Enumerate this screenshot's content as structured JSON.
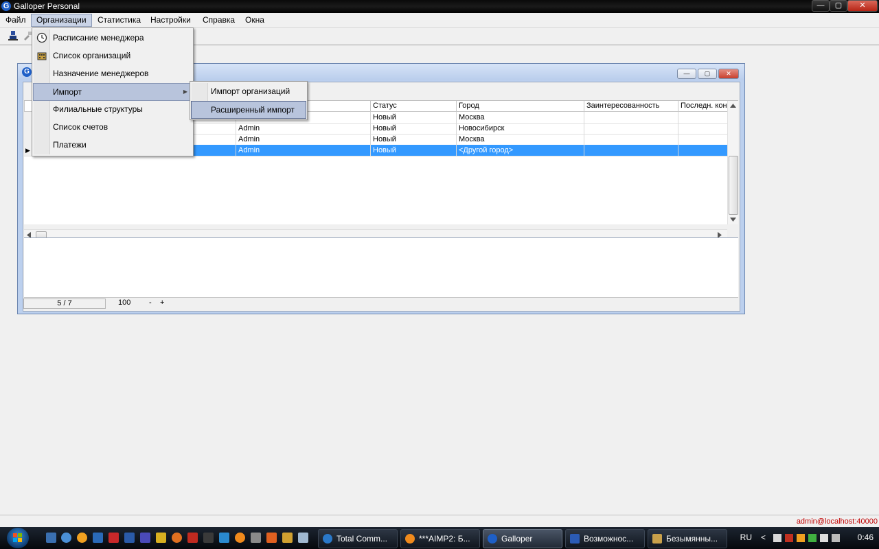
{
  "window": {
    "title": "Galloper Personal",
    "app_icon_letter": "G"
  },
  "window_buttons": {
    "minimize": "—",
    "maximize": "▢",
    "close": "✕"
  },
  "menubar": {
    "items": [
      {
        "label": "Файл"
      },
      {
        "label": "Организации",
        "active": true
      },
      {
        "label": "Статистика"
      },
      {
        "label": "Настройки"
      },
      {
        "label": "Справка"
      },
      {
        "label": "Окна"
      }
    ]
  },
  "dropdown": {
    "items": [
      {
        "label": "Расписание менеджера",
        "icon": "clock-icon"
      },
      {
        "label": "Список организаций",
        "icon": "building-icon"
      },
      {
        "label": "Назначение менеджеров",
        "icon": ""
      },
      {
        "label": "Импорт",
        "icon": "",
        "highlighted": true,
        "submenu_arrow": "▶"
      },
      {
        "label": "Филиальные структуры",
        "icon": ""
      },
      {
        "label": "Список счетов",
        "icon": ""
      },
      {
        "label": "Платежи",
        "icon": ""
      }
    ]
  },
  "submenu": {
    "items": [
      {
        "label": "Импорт организаций"
      },
      {
        "label": "Расширенный импорт",
        "highlighted": true
      }
    ]
  },
  "child_window": {
    "icon_letter": "G",
    "buttons": {
      "min": "—",
      "max": "▢",
      "close": "✕"
    }
  },
  "grid": {
    "columns": [
      "Статус",
      "Город",
      "Заинтересованность",
      "Последн. кон"
    ],
    "rows": [
      {
        "manager": "",
        "status": "Новый",
        "city": "Москва",
        "interest": "",
        "last": "",
        "selected": false
      },
      {
        "manager": "Admin",
        "status": "Новый",
        "city": "Новосибирск",
        "interest": "",
        "last": "",
        "selected": false
      },
      {
        "manager": "Admin",
        "status": "Новый",
        "city": "Москва",
        "interest": "",
        "last": "",
        "selected": false
      },
      {
        "manager": "Admin",
        "status": "Новый",
        "city": "<Другой город>",
        "interest": "",
        "last": "",
        "selected": true
      }
    ],
    "current_row_marker": "▶"
  },
  "statusline": {
    "position": "5 / 7",
    "page_size": "100",
    "minus": "-",
    "plus": "+"
  },
  "app_status": {
    "connection": "admin@localhost:40000"
  },
  "taskbar": {
    "buttons": [
      {
        "label": "Total Comm...",
        "color": "#2a78c8",
        "active": false
      },
      {
        "label": "***AIMP2: Б...",
        "color": "#f08a1c",
        "active": false
      },
      {
        "label": "Galloper",
        "color": "#1e5fc7",
        "active": true
      },
      {
        "label": "Возможнос...",
        "color": "#2b5bb5",
        "active": false
      },
      {
        "label": "Безымянны...",
        "color": "#c9a04a",
        "active": false
      }
    ],
    "tray": {
      "lang": "RU",
      "arrow": "<",
      "clock": "0:46"
    }
  }
}
